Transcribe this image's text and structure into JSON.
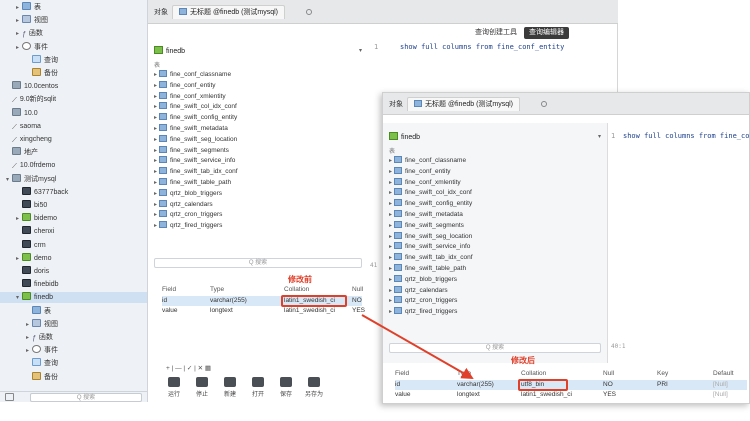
{
  "sidebar": {
    "items": [
      {
        "label": "表",
        "icon": "table-icon",
        "indent": 1,
        "caret": "▸"
      },
      {
        "label": "视图",
        "icon": "view-icon",
        "indent": 1,
        "caret": "▸"
      },
      {
        "label": "函数",
        "icon": "function-icon",
        "indent": 1,
        "caret": "▸"
      },
      {
        "label": "事件",
        "icon": "event-icon",
        "indent": 1,
        "caret": "▸"
      },
      {
        "label": "查询",
        "icon": "query-icon",
        "indent": 2,
        "caret": ""
      },
      {
        "label": "备份",
        "icon": "backup-icon",
        "indent": 2,
        "caret": ""
      },
      {
        "label": "10.0centos",
        "icon": "connection-icon",
        "indent": 0,
        "caret": ""
      },
      {
        "label": "9.0新的sqlit",
        "icon": "leaf-icon",
        "indent": 0,
        "caret": ""
      },
      {
        "label": "10.0",
        "icon": "connection-icon",
        "indent": 0,
        "caret": ""
      },
      {
        "label": "saoma",
        "icon": "leaf-icon",
        "indent": 0,
        "caret": ""
      },
      {
        "label": "xingcheng",
        "icon": "leaf-icon",
        "indent": 0,
        "caret": ""
      },
      {
        "label": "地产",
        "icon": "connection-icon",
        "indent": 0,
        "caret": ""
      },
      {
        "label": "10.0frdemo",
        "icon": "leaf-icon",
        "indent": 0,
        "caret": ""
      },
      {
        "label": "测试mysql",
        "icon": "connection-icon",
        "indent": 0,
        "caret": "▾"
      },
      {
        "label": "63777back",
        "icon": "database-icon",
        "indent": 1,
        "caret": ""
      },
      {
        "label": "bi50",
        "icon": "database-icon",
        "indent": 1,
        "caret": ""
      },
      {
        "label": "bidemo",
        "icon": "database-green-icon",
        "indent": 1,
        "caret": "▸"
      },
      {
        "label": "chenxi",
        "icon": "database-icon",
        "indent": 1,
        "caret": ""
      },
      {
        "label": "crm",
        "icon": "database-icon",
        "indent": 1,
        "caret": ""
      },
      {
        "label": "demo",
        "icon": "database-green-icon",
        "indent": 1,
        "caret": "▸"
      },
      {
        "label": "doris",
        "icon": "database-icon",
        "indent": 1,
        "caret": ""
      },
      {
        "label": "finebidb",
        "icon": "database-icon",
        "indent": 1,
        "caret": ""
      },
      {
        "label": "finedb",
        "icon": "database-green-icon",
        "indent": 1,
        "caret": "▾",
        "selected": true
      },
      {
        "label": "表",
        "icon": "table-icon",
        "indent": 2,
        "caret": ""
      },
      {
        "label": "视图",
        "icon": "view-icon",
        "indent": 2,
        "caret": "▸"
      },
      {
        "label": "函数",
        "icon": "function-icon",
        "indent": 2,
        "caret": "▸"
      },
      {
        "label": "事件",
        "icon": "event-icon",
        "indent": 2,
        "caret": "▸"
      },
      {
        "label": "查询",
        "icon": "query-icon",
        "indent": 2,
        "caret": ""
      },
      {
        "label": "备份",
        "icon": "backup-icon",
        "indent": 2,
        "caret": ""
      }
    ],
    "search_placeholder": "Q 搜索"
  },
  "win1": {
    "tab_objects": "对象",
    "tab_title": "无标题 @finedb (测试mysql)",
    "tool_query_builder": "查询创建工具",
    "tool_query_editor": "查询编辑器",
    "db_name": "finedb",
    "list_header": "表",
    "tables": [
      "fine_conf_classname",
      "fine_conf_entity",
      "fine_conf_xmlentity",
      "fine_swift_col_idx_conf",
      "fine_swift_config_entity",
      "fine_swift_metadata",
      "fine_swift_seg_location",
      "fine_swift_segments",
      "fine_swift_service_info",
      "fine_swift_tab_idx_conf",
      "fine_swift_table_path",
      "qrtz_blob_triggers",
      "qrtz_calendars",
      "qrtz_cron_triggers",
      "qrtz_fired_triggers"
    ],
    "search_placeholder": "Q 搜索",
    "sql_line_no": "1",
    "sql": "show full columns from fine_conf_entity",
    "result_label": "修改前",
    "grid_headers": [
      "Field",
      "Type",
      "Collation",
      "Null"
    ],
    "grid_rows": [
      [
        "id",
        "varchar(255)",
        "latin1_swedish_ci",
        "NO"
      ],
      [
        "value",
        "longtext",
        "latin1_swedish_ci",
        "YES"
      ]
    ],
    "mini_toolbar": "+  |  —  |  ✓  |  ✕      ▦",
    "bottom_tools": [
      "运行",
      "停止",
      "新建",
      "打开",
      "保存",
      "另存为"
    ],
    "cut_label": "41"
  },
  "win2": {
    "tab_objects": "对象",
    "tab_title": "无标题 @finedb (测试mysql)",
    "db_name": "finedb",
    "list_header": "表",
    "tables": [
      "fine_conf_classname",
      "fine_conf_entity",
      "fine_conf_xmlentity",
      "fine_swift_col_idx_conf",
      "fine_swift_config_entity",
      "fine_swift_metadata",
      "fine_swift_segments",
      "fine_swift_seg_location",
      "fine_swift_service_info",
      "fine_swift_tab_idx_conf",
      "fine_swift_table_path",
      "qrtz_blob_triggers",
      "qrtz_calendars",
      "qrtz_cron_triggers",
      "qrtz_fired_triggers"
    ],
    "search_placeholder": "Q 搜索",
    "sql_line_no": "1",
    "sql": "show full columns from fine_con",
    "position": "40:1",
    "result_label": "修改后",
    "grid_headers": [
      "Field",
      "Type",
      "Collation",
      "Null",
      "Key",
      "Default"
    ],
    "grid_rows": [
      [
        "id",
        "varchar(255)",
        "utf8_bin",
        "NO",
        "PRI",
        "[Null]"
      ],
      [
        "value",
        "longtext",
        "latin1_swedish_ci",
        "YES",
        "",
        "[Null]"
      ]
    ]
  },
  "colors": {
    "accent_red": "#e0402a",
    "selection_blue": "#d9e8f7",
    "sql_blue": "#1c3f8c",
    "db_green": "#7cc04b"
  }
}
